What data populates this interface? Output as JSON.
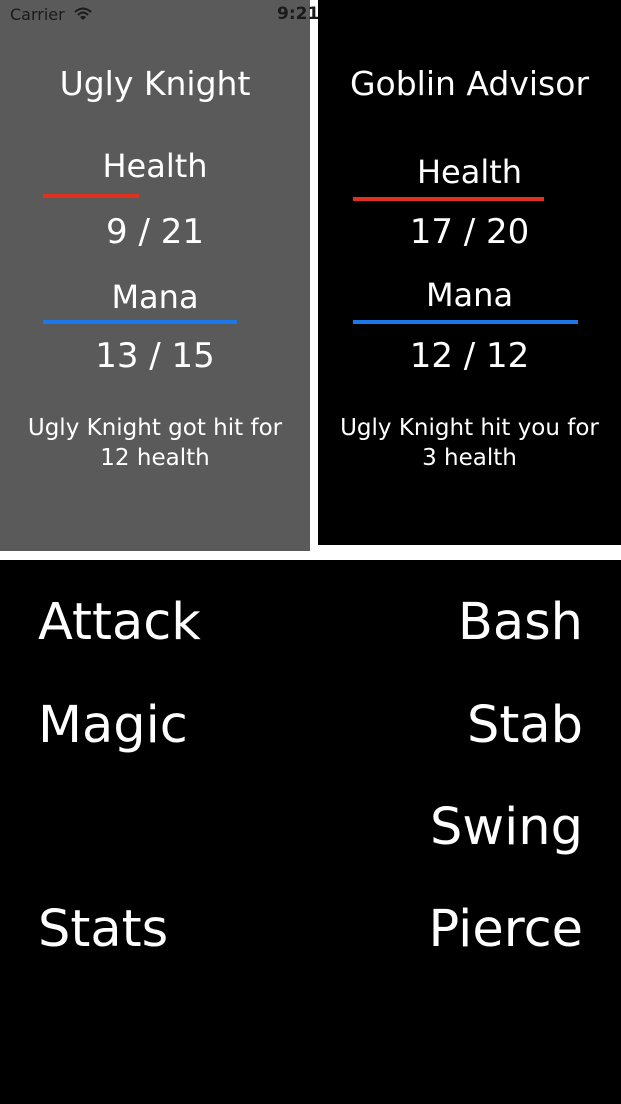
{
  "status_bar": {
    "carrier": "Carrier",
    "time": "9:21",
    "wifi_icon": "wifi-icon"
  },
  "player": {
    "name": "Ugly Knight",
    "health_label": "Health",
    "health_value": "9 / 21",
    "health_fraction": 0.43,
    "mana_label": "Mana",
    "mana_value": "13 / 15",
    "mana_fraction": 0.87,
    "message": "Ugly Knight got hit for 12 health",
    "background": "#5a5a5a"
  },
  "enemy": {
    "name": "Goblin Advisor",
    "health_label": "Health",
    "health_value": "17 / 20",
    "health_fraction": 0.85,
    "mana_label": "Mana",
    "mana_value": "12 / 12",
    "mana_fraction": 1.0,
    "message": "Ugly Knight hit you for 3 health",
    "background": "#000000"
  },
  "colors": {
    "health": "#e0311f",
    "mana": "#1a78e8"
  },
  "actions": {
    "attack": "Attack",
    "magic": "Magic",
    "stats": "Stats",
    "bash": "Bash",
    "stab": "Stab",
    "swing": "Swing",
    "pierce": "Pierce"
  }
}
